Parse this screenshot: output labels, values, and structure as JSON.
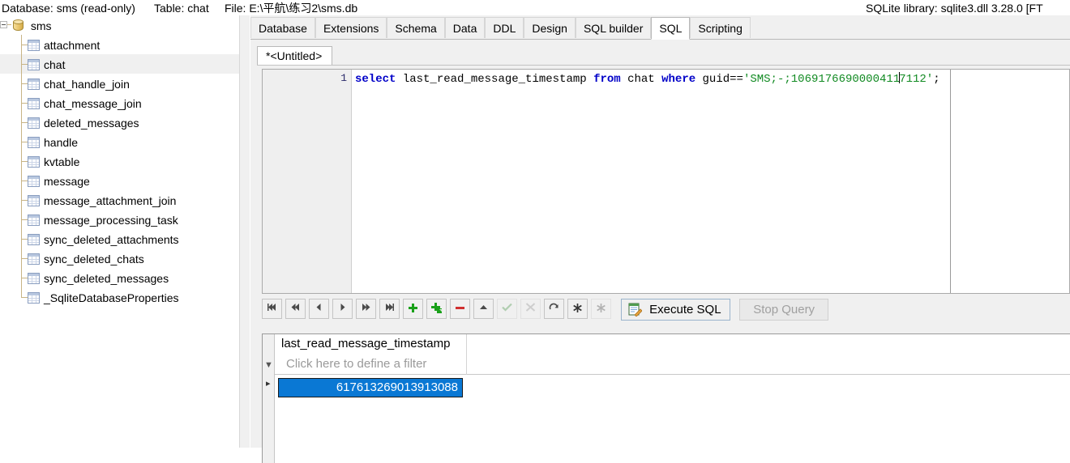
{
  "titlebar": {
    "database": "Database: sms (read-only)",
    "table": "Table: chat",
    "file": "File: E:\\平航\\练习2\\sms.db",
    "library": "SQLite library: sqlite3.dll 3.28.0 [FT"
  },
  "tree": {
    "root": {
      "label": "sms",
      "icon": "database-icon"
    },
    "items": [
      {
        "label": "attachment",
        "icon": "table-icon",
        "selected": false
      },
      {
        "label": "chat",
        "icon": "table-icon",
        "selected": true
      },
      {
        "label": "chat_handle_join",
        "icon": "table-icon",
        "selected": false
      },
      {
        "label": "chat_message_join",
        "icon": "table-icon",
        "selected": false
      },
      {
        "label": "deleted_messages",
        "icon": "table-icon",
        "selected": false
      },
      {
        "label": "handle",
        "icon": "table-icon",
        "selected": false
      },
      {
        "label": "kvtable",
        "icon": "table-icon",
        "selected": false
      },
      {
        "label": "message",
        "icon": "table-icon",
        "selected": false
      },
      {
        "label": "message_attachment_join",
        "icon": "table-icon",
        "selected": false
      },
      {
        "label": "message_processing_task",
        "icon": "table-icon",
        "selected": false
      },
      {
        "label": "sync_deleted_attachments",
        "icon": "table-icon",
        "selected": false
      },
      {
        "label": "sync_deleted_chats",
        "icon": "table-icon",
        "selected": false
      },
      {
        "label": "sync_deleted_messages",
        "icon": "table-icon",
        "selected": false
      },
      {
        "label": "_SqliteDatabaseProperties",
        "icon": "table-icon",
        "selected": false
      }
    ]
  },
  "tabs": [
    {
      "label": "Database",
      "active": false
    },
    {
      "label": "Extensions",
      "active": false
    },
    {
      "label": "Schema",
      "active": false
    },
    {
      "label": "Data",
      "active": false
    },
    {
      "label": "DDL",
      "active": false
    },
    {
      "label": "Design",
      "active": false
    },
    {
      "label": "SQL builder",
      "active": false
    },
    {
      "label": "SQL",
      "active": true
    },
    {
      "label": "Scripting",
      "active": false
    }
  ],
  "subtab": {
    "label": "*<Untitled>"
  },
  "editor": {
    "line_number": "1",
    "tokens": [
      {
        "text": "select",
        "type": "kw"
      },
      {
        "text": " ",
        "type": "id"
      },
      {
        "text": "last_read_message_timestamp",
        "type": "id"
      },
      {
        "text": " ",
        "type": "id"
      },
      {
        "text": "from",
        "type": "kw"
      },
      {
        "text": " ",
        "type": "id"
      },
      {
        "text": "chat",
        "type": "id"
      },
      {
        "text": " ",
        "type": "id"
      },
      {
        "text": "where",
        "type": "kw"
      },
      {
        "text": " ",
        "type": "id"
      },
      {
        "text": "guid",
        "type": "id"
      },
      {
        "text": "==",
        "type": "op"
      },
      {
        "text": "'SMS;-;10691766900004117112'",
        "type": "str"
      },
      {
        "text": ";",
        "type": "op"
      }
    ],
    "full_text": "select last_read_message_timestamp from chat where guid=='SMS;-;10691766900004117112';"
  },
  "toolbar": {
    "buttons": [
      {
        "name": "first-record-button",
        "icon": "skip-to-start-icon",
        "disabled": false
      },
      {
        "name": "prior-page-button",
        "icon": "rewind-icon",
        "disabled": false
      },
      {
        "name": "prior-record-button",
        "icon": "step-back-icon",
        "disabled": false
      },
      {
        "name": "next-record-button",
        "icon": "step-forward-icon",
        "disabled": false
      },
      {
        "name": "next-page-button",
        "icon": "fast-forward-icon",
        "disabled": false
      },
      {
        "name": "last-record-button",
        "icon": "skip-to-end-icon",
        "disabled": false
      },
      {
        "name": "insert-record-button",
        "icon": "plus-icon",
        "disabled": false
      },
      {
        "name": "copy-record-button",
        "icon": "plus-copy-icon",
        "disabled": false
      },
      {
        "name": "delete-record-button",
        "icon": "minus-icon",
        "disabled": false
      },
      {
        "name": "collapse-button",
        "icon": "caret-up-icon",
        "disabled": false
      },
      {
        "name": "post-edit-button",
        "icon": "check-icon",
        "disabled": true
      },
      {
        "name": "cancel-edit-button",
        "icon": "cross-icon",
        "disabled": true
      },
      {
        "name": "refresh-button",
        "icon": "refresh-icon",
        "disabled": false
      },
      {
        "name": "clear-filter-button",
        "icon": "asterisk-icon",
        "disabled": false
      },
      {
        "name": "secondary-asterisk-button",
        "icon": "asterisk-icon",
        "disabled": true
      }
    ],
    "execute_label": "Execute SQL",
    "execute_icon": "execute-sql-icon",
    "stop_label": "Stop Query",
    "stop_disabled": true
  },
  "results": {
    "columns": [
      "last_read_message_timestamp"
    ],
    "filter_placeholder": "Click here to define a filter",
    "rows": [
      {
        "last_read_message_timestamp": "617613269013913088",
        "selected": true
      }
    ]
  },
  "colors": {
    "selection_blue": "#0a78d4",
    "keyword_blue": "#0000c8",
    "string_green": "#118a22",
    "chrome_gray": "#f0f0f0"
  }
}
